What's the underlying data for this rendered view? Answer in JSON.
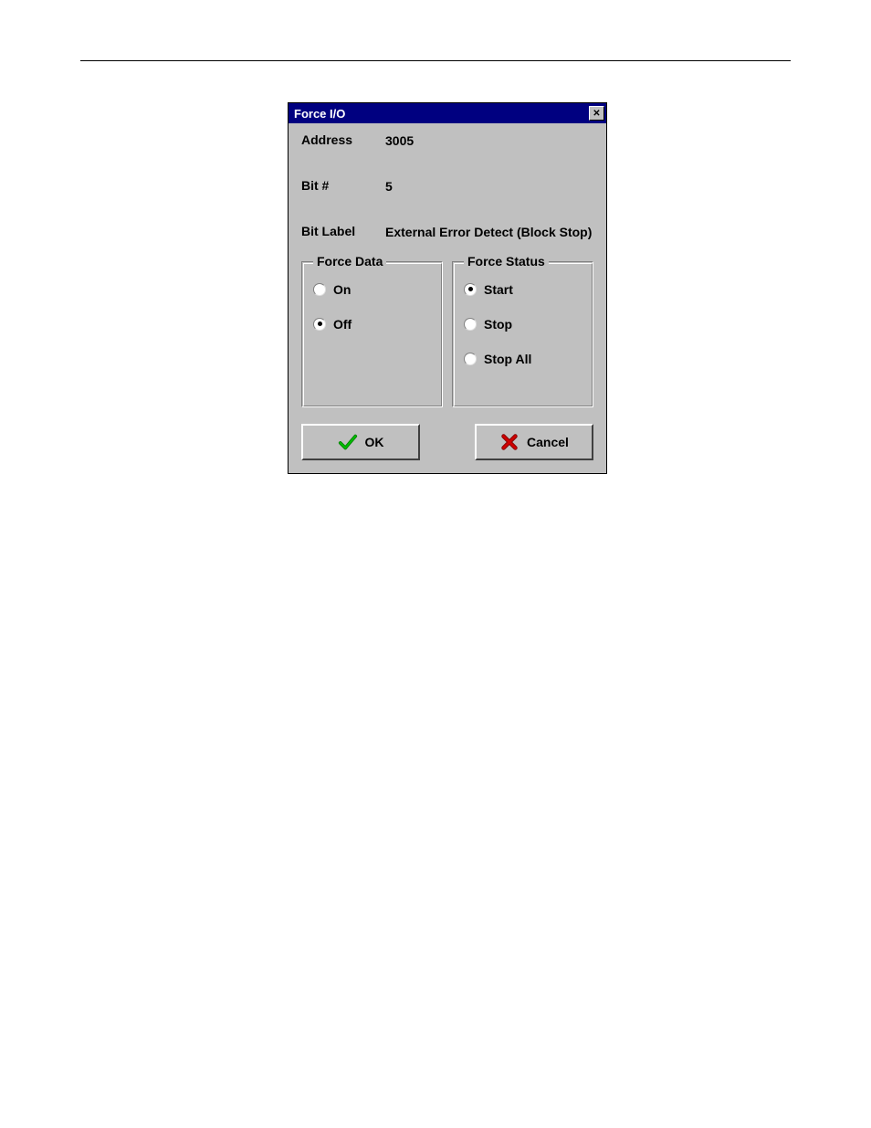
{
  "dialog": {
    "title": "Force I/O",
    "address_label": "Address",
    "address_value": "3005",
    "bit_label": "Bit #",
    "bit_value": "5",
    "bitlabel_label": "Bit Label",
    "bitlabel_value": "External Error Detect (Block Stop)",
    "force_data": {
      "legend": "Force Data",
      "options": {
        "on": "On",
        "off": "Off"
      },
      "selected": "off"
    },
    "force_status": {
      "legend": "Force Status",
      "options": {
        "start": "Start",
        "stop": "Stop",
        "stop_all": "Stop All"
      },
      "selected": "start"
    },
    "buttons": {
      "ok": "OK",
      "cancel": "Cancel"
    }
  }
}
